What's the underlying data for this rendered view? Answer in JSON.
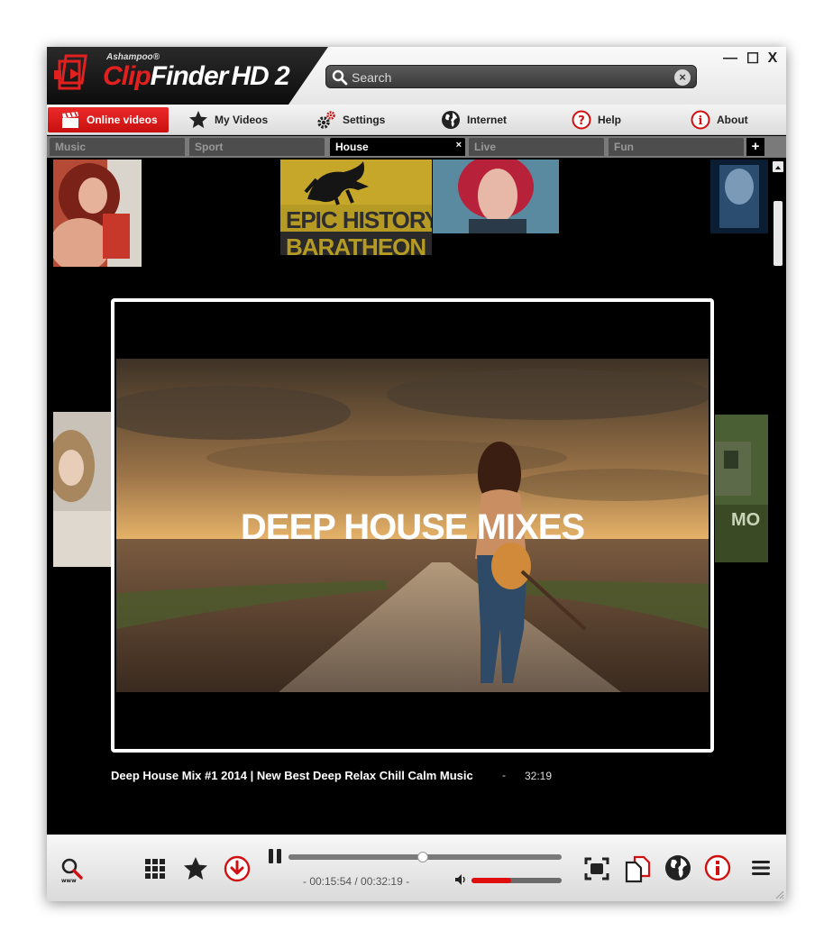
{
  "app": {
    "brand": "Ashampoo®",
    "name_clip": "Clip",
    "name_finder": "Finder",
    "name_hd": "HD 2"
  },
  "window_controls": {
    "minimize": "—",
    "maximize": "☐",
    "close": "X"
  },
  "search": {
    "placeholder": "Search",
    "value": "",
    "clear": "×"
  },
  "nav": {
    "items": [
      {
        "label": "Online videos",
        "icon": "clapperboard-icon",
        "active": true
      },
      {
        "label": "My Videos",
        "icon": "star-icon"
      },
      {
        "label": "Settings",
        "icon": "gears-icon"
      },
      {
        "label": "Internet",
        "icon": "globe-icon"
      },
      {
        "label": "Help",
        "icon": "question-icon"
      },
      {
        "label": "About",
        "icon": "info-icon"
      }
    ]
  },
  "tabs": [
    {
      "label": "Music"
    },
    {
      "label": "Sport"
    },
    {
      "label": "House",
      "active": true,
      "close": "×"
    },
    {
      "label": "Live"
    },
    {
      "label": "Fun"
    }
  ],
  "tab_add": "+",
  "thumbnails": {
    "epic_history_line1": "EPIC HISTORY:",
    "epic_history_line2": "BARATHEON",
    "right_thumb_text": "MO"
  },
  "player": {
    "overlay_text": "DEEP HOUSE MIXES",
    "title": "Deep House Mix #1 2014 | New Best Deep Relax Chill Calm Music",
    "separator": "-",
    "duration": "32:19"
  },
  "controls": {
    "time_display": "- 00:15:54 / 00:32:19 -",
    "progress_fraction": 0.492,
    "volume_fraction": 0.44,
    "accent": "#e10e0e"
  }
}
